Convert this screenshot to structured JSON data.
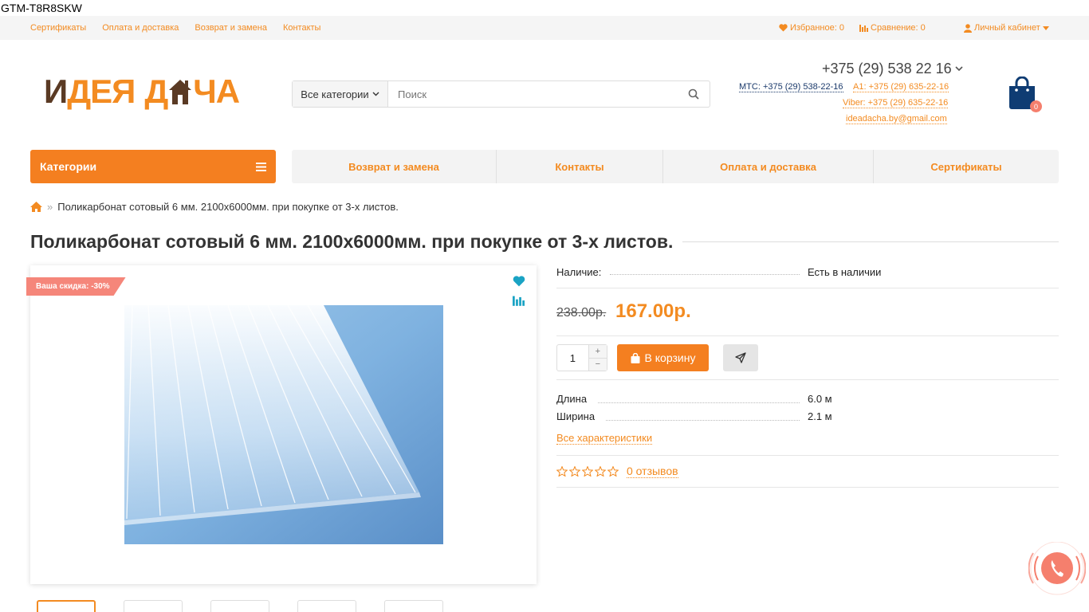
{
  "gtm": "GTM-T8R8SKW",
  "topbar": {
    "links": [
      "Сертификаты",
      "Оплата и доставка",
      "Возврат и замена",
      "Контакты"
    ],
    "favorites": "Избранное: 0",
    "compare": "Сравнение: 0",
    "account": "Личный кабинет"
  },
  "logo": {
    "part1": "И",
    "part2": "ДЕЯ",
    "part3": "Д",
    "part4": "ЧА"
  },
  "search": {
    "category": "Все категории",
    "placeholder": "Поиск"
  },
  "header": {
    "phone": "+375 (29) 538 22 16",
    "mts": "МТС: +375 (29) 538-22-16",
    "a1": "A1: +375 (29) 635-22-16",
    "viber": "Viber: +375 (29) 635-22-16",
    "email": "ideadacha.by@gmail.com",
    "cart_count": "0"
  },
  "menu": {
    "categories": "Категории",
    "items": [
      "Возврат и замена",
      "Контакты",
      "Оплата и доставка",
      "Сертификаты"
    ]
  },
  "breadcrumb": {
    "sep": "»",
    "current": "Поликарбонат сотовый 6 мм. 2100х6000мм. при покупке от 3-х листов."
  },
  "product": {
    "title": "Поликарбонат сотовый 6 мм. 2100х6000мм. при покупке от 3-х листов.",
    "discount": "Ваша скидка: -30%",
    "availability_label": "Наличие:",
    "availability_value": "Есть в наличии",
    "old_price": "238.00р.",
    "price": "167.00р.",
    "quantity": "1",
    "plus": "+",
    "minus": "−",
    "to_cart": "В корзину",
    "specs": [
      {
        "label": "Длина",
        "value": "6.0 м"
      },
      {
        "label": "Ширина",
        "value": "2.1 м"
      }
    ],
    "all_specs": "Все характеристики",
    "reviews": "0 отзывов",
    "rating": 0
  },
  "colors": {
    "accent": "#f38b21",
    "brown": "#5a3a24",
    "navy": "#1b3a6b",
    "discount": "#f5867a"
  }
}
